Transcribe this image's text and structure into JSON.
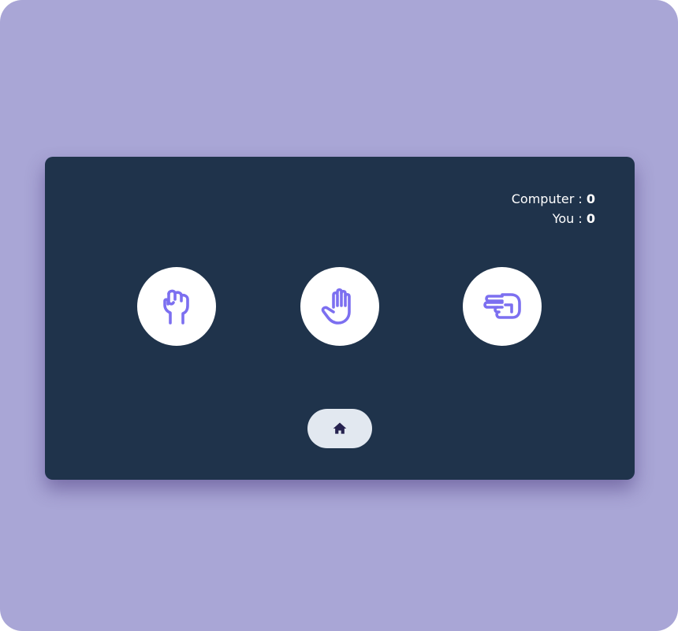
{
  "scoreboard": {
    "computer_label": "Computer : ",
    "computer_score": "0",
    "you_label": "You : ",
    "you_score": "0"
  },
  "choices": [
    {
      "name": "rock",
      "icon": "rock-fist-icon"
    },
    {
      "name": "paper",
      "icon": "paper-hand-icon"
    },
    {
      "name": "scissors",
      "icon": "scissors-hand-icon"
    }
  ],
  "home": {
    "icon": "home-icon"
  },
  "colors": {
    "background": "#a9a6d6",
    "card": "#1f334b",
    "icon_accent": "#7c6ff0",
    "choice_bg": "#ffffff",
    "home_bg": "#e2e8f0",
    "home_icon": "#26224f",
    "text": "#ffffff"
  }
}
